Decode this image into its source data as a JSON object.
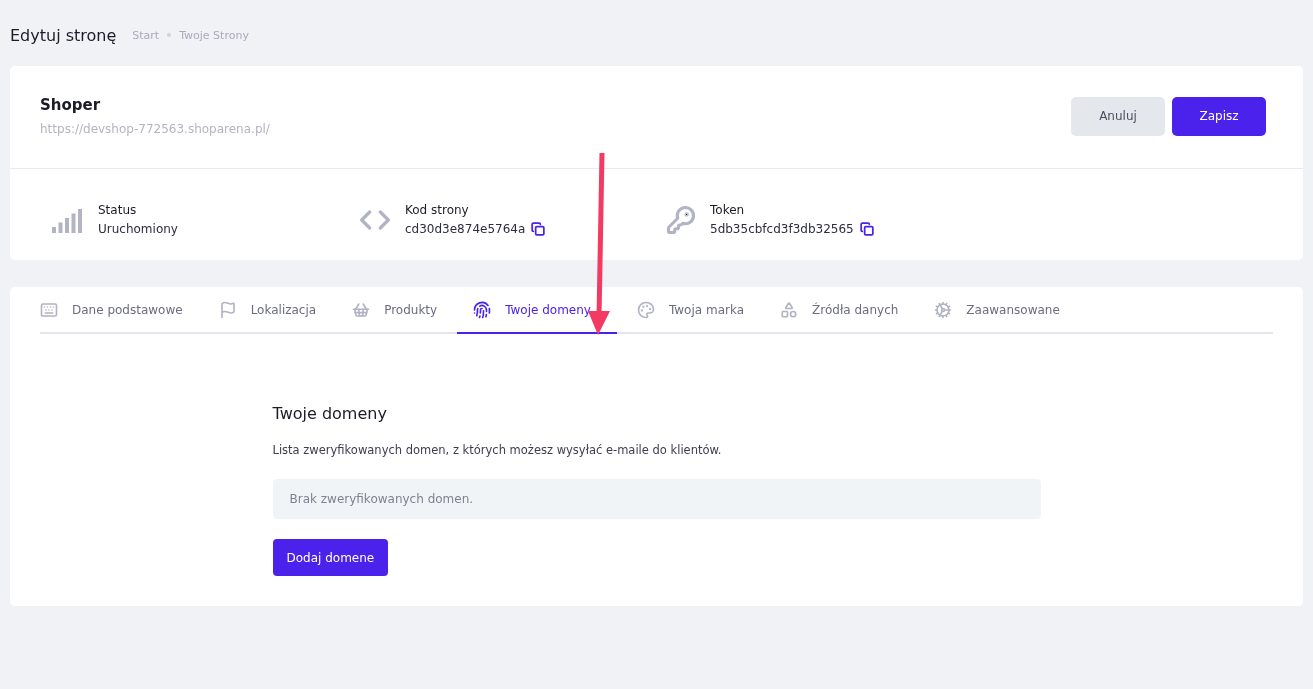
{
  "header": {
    "title": "Edytuj stronę",
    "breadcrumbs": [
      "Start",
      "Twoje Strony"
    ]
  },
  "site": {
    "name": "Shoper",
    "url": "https://devshop-772563.shoparena.pl/"
  },
  "actions": [
    {
      "label": "Anuluj",
      "kind": "secondary"
    },
    {
      "label": "Zapisz",
      "kind": "primary"
    }
  ],
  "info": [
    {
      "label": "Status",
      "value": "Uruchomiony",
      "copyable": false
    },
    {
      "label": "Kod strony",
      "value": "cd30d3e874e5764a",
      "copyable": true
    },
    {
      "label": "Token",
      "value": "5db35cbfcd3f3db32565",
      "copyable": true
    }
  ],
  "tabs": [
    {
      "label": "Dane podstawowe",
      "selected": false
    },
    {
      "label": "Lokalizacja",
      "selected": false
    },
    {
      "label": "Produkty",
      "selected": false
    },
    {
      "label": "Twoje domeny",
      "selected": true
    },
    {
      "label": "Twoja marka",
      "selected": false
    },
    {
      "label": "Źródła danych",
      "selected": false
    },
    {
      "label": "Zaawansowane",
      "selected": false
    }
  ],
  "section": {
    "title": "Twoje domeny",
    "description": "Lista zweryfikowanych domen, z których możesz wysyłać e-maile do klientów.",
    "empty_message": "Brak zweryfikowanych domen.",
    "button": "Dodaj domene"
  }
}
